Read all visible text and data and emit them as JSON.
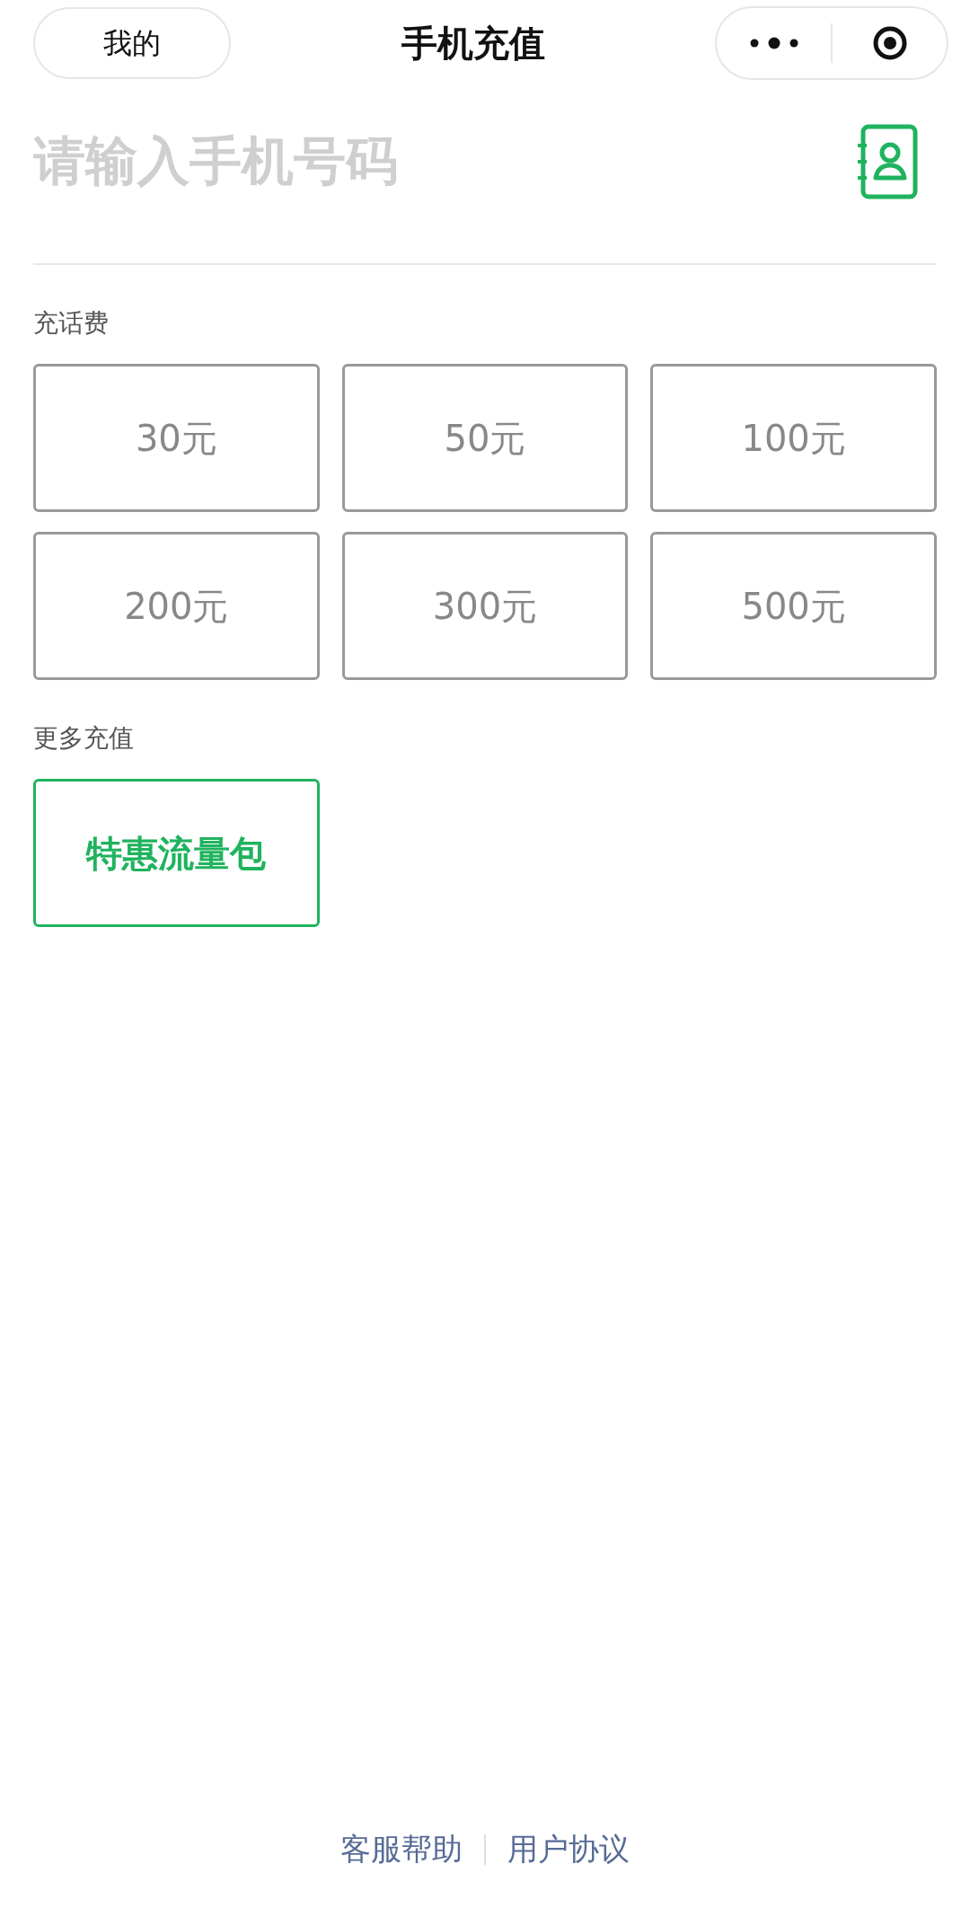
{
  "nav_bar": {
    "back_button": "我的",
    "title": "手机充值"
  },
  "phone_input": {
    "placeholder": "请输入手机号码"
  },
  "sections": [
    {
      "label": "充话费",
      "kind": "amount",
      "options": [
        "30元",
        "50元",
        "100元",
        "200元",
        "300元",
        "500元"
      ]
    },
    {
      "label": "更多充值",
      "kind": "promo",
      "options": [
        "特惠流量包"
      ]
    }
  ],
  "footer_links": [
    "客服帮助",
    "用户协议"
  ]
}
